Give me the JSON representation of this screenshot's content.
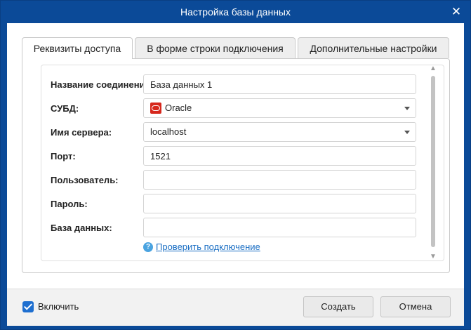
{
  "window": {
    "title": "Настройка базы данных"
  },
  "tabs": [
    {
      "label": "Реквизиты доступа",
      "active": true
    },
    {
      "label": "В форме строки подключения",
      "active": false
    },
    {
      "label": "Дополнительные настройки",
      "active": false
    }
  ],
  "form": {
    "connection_name": {
      "label": "Название соединения:",
      "value": "База данных 1"
    },
    "dbms": {
      "label": "СУБД:",
      "value": "Oracle",
      "icon": "oracle-icon"
    },
    "server": {
      "label": "Имя сервера:",
      "value": "localhost"
    },
    "port": {
      "label": "Порт:",
      "value": "1521"
    },
    "user": {
      "label": "Пользователь:",
      "value": ""
    },
    "password": {
      "label": "Пароль:",
      "value": ""
    },
    "database": {
      "label": "База данных:",
      "value": ""
    }
  },
  "help": {
    "link_text": "Проверить подключение",
    "icon": "help-icon"
  },
  "footer": {
    "enable_label": "Включить",
    "enable_checked": true,
    "create_label": "Создать",
    "cancel_label": "Отмена"
  },
  "colors": {
    "titlebar": "#0b4a98",
    "accent": "#1e6fd0",
    "link": "#1b6fc4",
    "oracle_brand": "#d6271c"
  }
}
